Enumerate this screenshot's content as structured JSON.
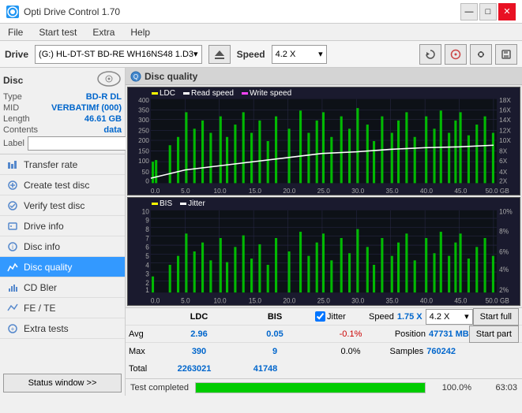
{
  "titlebar": {
    "title": "Opti Drive Control 1.70",
    "icon_label": "O",
    "minimize": "—",
    "maximize": "□",
    "close": "✕"
  },
  "menubar": {
    "items": [
      "File",
      "Start test",
      "Extra",
      "Help"
    ]
  },
  "drivebar": {
    "drive_label": "Drive",
    "drive_value": "(G:) HL-DT-ST BD-RE  WH16NS48 1.D3",
    "speed_label": "Speed",
    "speed_value": "4.2 X"
  },
  "disc": {
    "title": "Disc",
    "type_label": "Type",
    "type_value": "BD-R DL",
    "mid_label": "MID",
    "mid_value": "VERBATIMf (000)",
    "length_label": "Length",
    "length_value": "46.61 GB",
    "contents_label": "Contents",
    "contents_value": "data",
    "label_label": "Label",
    "label_placeholder": ""
  },
  "nav_items": [
    {
      "id": "transfer-rate",
      "label": "Transfer rate",
      "active": false
    },
    {
      "id": "create-test-disc",
      "label": "Create test disc",
      "active": false
    },
    {
      "id": "verify-test-disc",
      "label": "Verify test disc",
      "active": false
    },
    {
      "id": "drive-info",
      "label": "Drive info",
      "active": false
    },
    {
      "id": "disc-info",
      "label": "Disc info",
      "active": false
    },
    {
      "id": "disc-quality",
      "label": "Disc quality",
      "active": true
    },
    {
      "id": "cd-bler",
      "label": "CD Bler",
      "active": false
    },
    {
      "id": "fe-te",
      "label": "FE / TE",
      "active": false
    },
    {
      "id": "extra-tests",
      "label": "Extra tests",
      "active": false
    }
  ],
  "status_btn": "Status window >>",
  "quality": {
    "title": "Disc quality",
    "legend": {
      "ldc": "LDC",
      "read_speed": "Read speed",
      "write_speed": "Write speed"
    },
    "legend2": {
      "bis": "BIS",
      "jitter": "Jitter"
    },
    "chart1": {
      "y_labels": [
        "400",
        "350",
        "300",
        "250",
        "200",
        "150",
        "100",
        "50",
        "0"
      ],
      "y_labels_right": [
        "18X",
        "16X",
        "14X",
        "12X",
        "10X",
        "8X",
        "6X",
        "4X",
        "2X"
      ],
      "x_labels": [
        "0.0",
        "5.0",
        "10.0",
        "15.0",
        "20.0",
        "25.0",
        "30.0",
        "35.0",
        "40.0",
        "45.0",
        "50.0 GB"
      ]
    },
    "chart2": {
      "y_labels": [
        "10",
        "9",
        "8",
        "7",
        "6",
        "5",
        "4",
        "3",
        "2",
        "1"
      ],
      "y_labels_right": [
        "10%",
        "8%",
        "6%",
        "4%",
        "2%"
      ],
      "x_labels": [
        "0.0",
        "5.0",
        "10.0",
        "15.0",
        "20.0",
        "25.0",
        "30.0",
        "35.0",
        "40.0",
        "45.0",
        "50.0 GB"
      ]
    }
  },
  "stats": {
    "headers": [
      "",
      "LDC",
      "BIS",
      "",
      "Jitter",
      "Speed",
      "",
      ""
    ],
    "avg_label": "Avg",
    "avg_ldc": "2.96",
    "avg_bis": "0.05",
    "avg_jitter": "-0.1%",
    "max_label": "Max",
    "max_ldc": "390",
    "max_bis": "9",
    "max_jitter": "0.0%",
    "total_label": "Total",
    "total_ldc": "2263021",
    "total_bis": "41748",
    "speed_label": "Speed",
    "speed_value": "1.75 X",
    "speed_select": "4.2 X",
    "position_label": "Position",
    "position_value": "47731 MB",
    "samples_label": "Samples",
    "samples_value": "760242",
    "jitter_checked": true,
    "start_full": "Start full",
    "start_part": "Start part"
  },
  "progress": {
    "status_text": "Test completed",
    "percent": "100.0%",
    "time": "63:03"
  }
}
